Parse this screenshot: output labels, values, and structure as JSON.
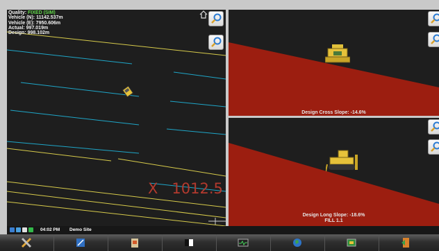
{
  "plan": {
    "quality_label": "Quality:",
    "quality_value": "FIXED (SIM)",
    "vehicle_n": "Vehicle (N): 11142.537m",
    "vehicle_e": "Vehicle (E): 7950.606m",
    "actual": "Actual: 997.019m",
    "design": "Design: 998.102m",
    "grid_label": "X   1012.5"
  },
  "cross_view": {
    "caption": "Design Cross Slope: -14.6%"
  },
  "long_view": {
    "caption": "Design Long Slope: -18.6%",
    "fill": "FILL 1.1"
  },
  "status": {
    "time": "04:02 PM",
    "site": "Demo Site"
  },
  "toolbar": {
    "icons": [
      "tools-icon",
      "design-icon",
      "clipboard-icon",
      "view-icon",
      "monitor-icon",
      "globe-icon",
      "machine-icon",
      "exit-icon"
    ]
  },
  "colors": {
    "fill_red": "#9c1e10",
    "quality_green": "#62d64a",
    "blue_line": "#1fa7c9",
    "yellow_line": "#d8cc4b"
  }
}
